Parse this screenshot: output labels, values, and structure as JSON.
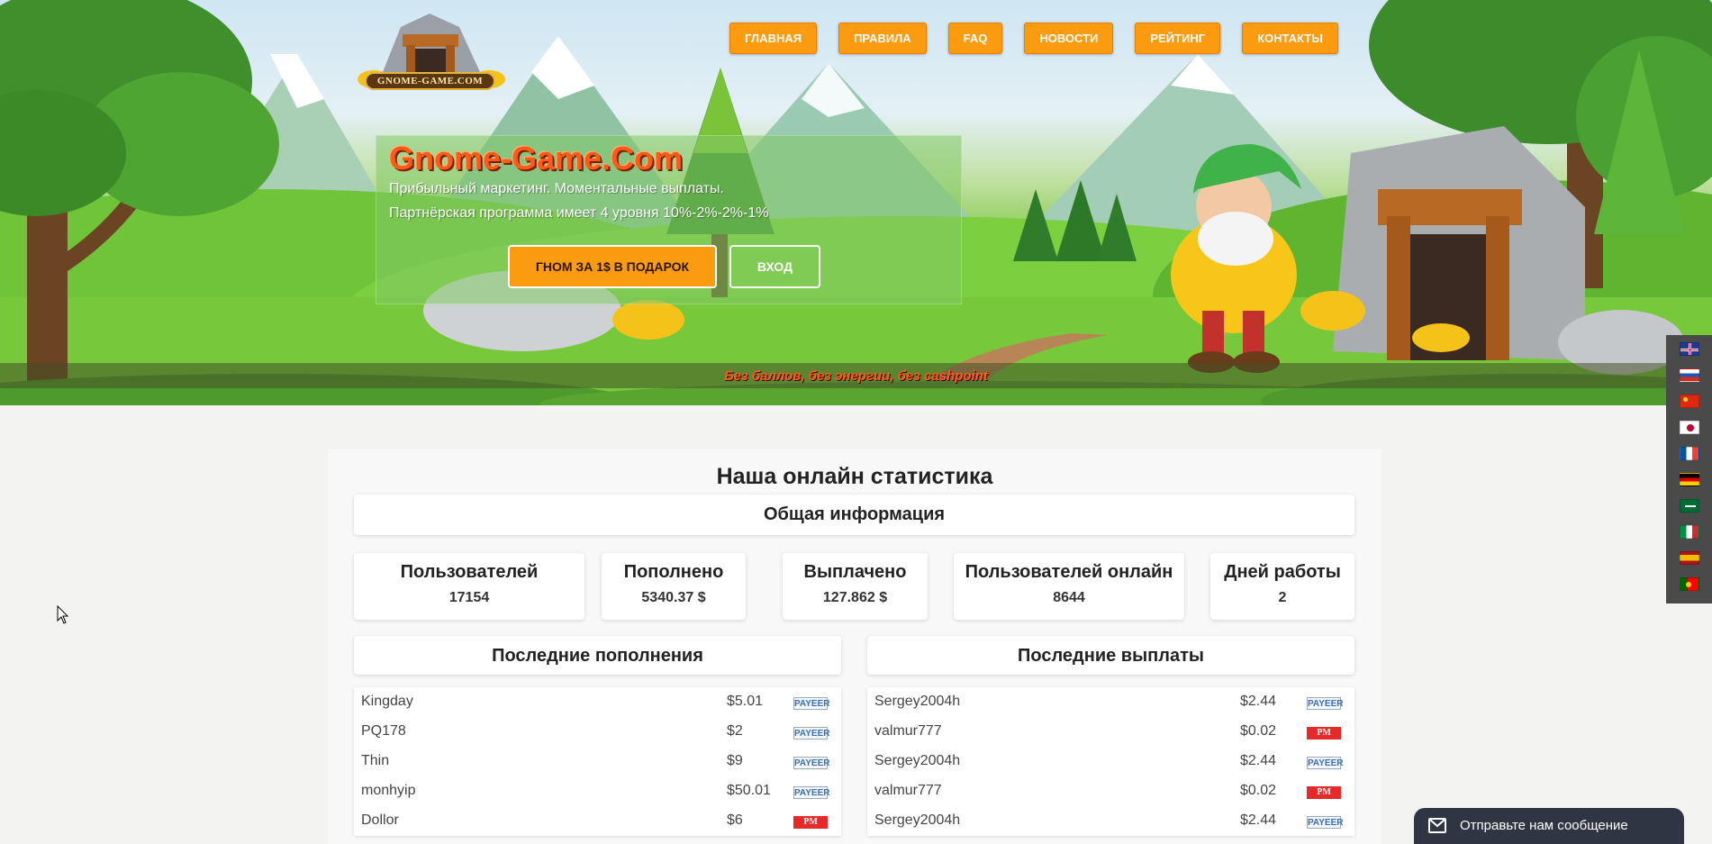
{
  "nav": {
    "items": [
      "ГЛАВНАЯ",
      "ПРАВИЛА",
      "FAQ",
      "НОВОСТИ",
      "РЕЙТИНГ",
      "КОНТАКТЫ"
    ]
  },
  "logo": {
    "text": "GNOME-GAME.COM"
  },
  "hero": {
    "title": "Gnome-Game.Com",
    "line1": "Прибыльный маркетинг. Моментальные выплаты.",
    "line2": "Партнёрская программа имеет 4 уровня 10%-2%-2%-1%",
    "gift_button": "ГНОМ ЗА 1$ В ПОДАРОК",
    "login_button": "ВХОД",
    "strip": "Без баллов, без энергии, без cashpoint"
  },
  "languages": [
    "en",
    "ru",
    "cn",
    "jp",
    "fr",
    "de",
    "sa",
    "it",
    "es",
    "pt"
  ],
  "stats": {
    "title": "Наша онлайн статистика",
    "general": "Общая информация",
    "items": [
      {
        "label": "Пользователей",
        "value": "17154"
      },
      {
        "label": "Пополнено",
        "value": "5340.37 $"
      },
      {
        "label": "Выплачено",
        "value": "127.862 $"
      },
      {
        "label": "Пользователей онлайн",
        "value": "8644"
      },
      {
        "label": "Дней работы",
        "value": "2"
      }
    ]
  },
  "deposits": {
    "title": "Последние пополнения",
    "rows": [
      {
        "user": "Kingday",
        "amount": "$5.01",
        "method": "PAYEER"
      },
      {
        "user": "PQ178",
        "amount": "$2",
        "method": "PAYEER"
      },
      {
        "user": "Thin",
        "amount": "$9",
        "method": "PAYEER"
      },
      {
        "user": "monhyip",
        "amount": "$50.01",
        "method": "PAYEER"
      },
      {
        "user": "Dollor",
        "amount": "$6",
        "method": "PM"
      }
    ]
  },
  "payouts": {
    "title": "Последние выплаты",
    "rows": [
      {
        "user": "Sergey2004h",
        "amount": "$2.44",
        "method": "PAYEER"
      },
      {
        "user": "valmur777",
        "amount": "$0.02",
        "method": "PM"
      },
      {
        "user": "Sergey2004h",
        "amount": "$2.44",
        "method": "PAYEER"
      },
      {
        "user": "valmur777",
        "amount": "$0.02",
        "method": "PM"
      },
      {
        "user": "Sergey2004h",
        "amount": "$2.44",
        "method": "PAYEER"
      }
    ]
  },
  "chat": {
    "label": "Отправьте нам сообщение"
  },
  "colors": {
    "accent": "#fb9b10",
    "title_orange": "#ff5b14",
    "pm_red": "#e62a2a",
    "payeer_blue": "#3a6fb0"
  }
}
